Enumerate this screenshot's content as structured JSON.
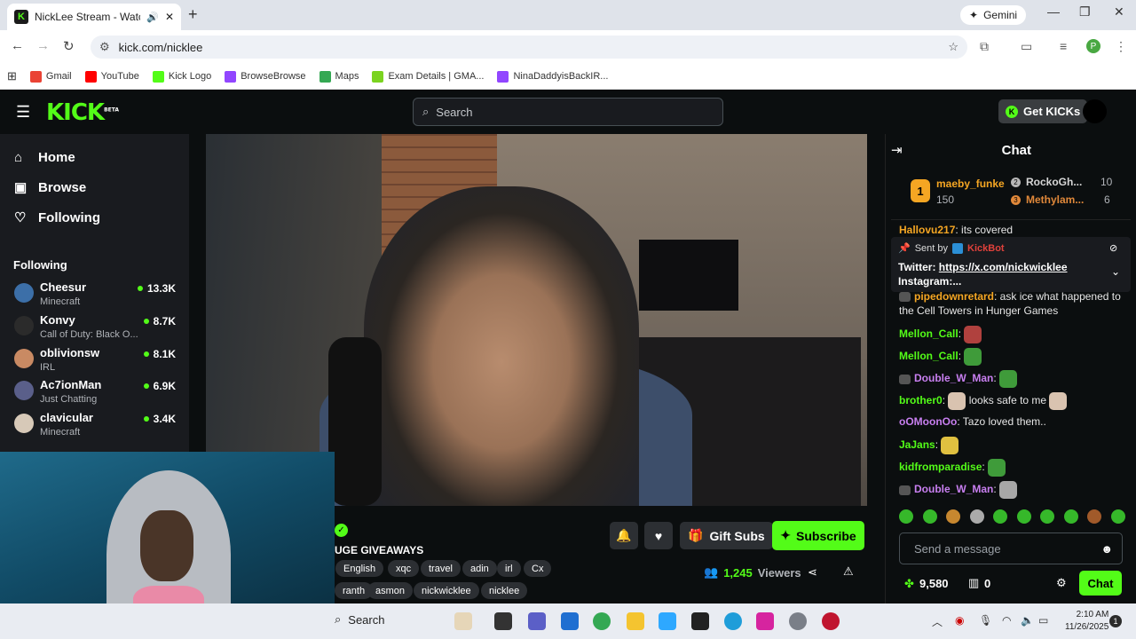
{
  "browser": {
    "tab_title": "NickLee Stream - Watch Liv",
    "gemini_label": "Gemini",
    "url": "kick.com/nicklee",
    "profile_initial": "P",
    "bookmarks": [
      {
        "label": "Gmail",
        "color": "#ea4335"
      },
      {
        "label": "YouTube",
        "color": "#ff0000"
      },
      {
        "label": "Kick Logo",
        "color": "#53fc18"
      },
      {
        "label": "BrowseBrowse",
        "color": "#9146ff"
      },
      {
        "label": "Maps",
        "color": "#34a853"
      },
      {
        "label": "Exam Details | GMA...",
        "color": "#7bd320"
      },
      {
        "label": "NinaDaddyisBackIR...",
        "color": "#9146ff"
      }
    ]
  },
  "header": {
    "logo": "KICK",
    "logo_badge": "BETA",
    "search_placeholder": "Search",
    "get_kicks_label": "Get KICKs"
  },
  "sidebar": {
    "nav": [
      {
        "label": "Home",
        "icon": "home-icon"
      },
      {
        "label": "Browse",
        "icon": "browse-icon"
      },
      {
        "label": "Following",
        "icon": "heart-icon"
      }
    ],
    "following_heading": "Following",
    "following": [
      {
        "name": "Cheesur",
        "category": "Minecraft",
        "viewers": "13.3K",
        "avatar_color": "#3c6fa8"
      },
      {
        "name": "Konvy",
        "category": "Call of Duty: Black O...",
        "viewers": "8.7K",
        "avatar_color": "#2b2b2b"
      },
      {
        "name": "oblivionsw",
        "category": "IRL",
        "viewers": "8.1K",
        "avatar_color": "#c98a63"
      },
      {
        "name": "Ac7ionMan",
        "category": "Just Chatting",
        "viewers": "6.9K",
        "avatar_color": "#5a5f8a"
      },
      {
        "name": "clavicular",
        "category": "Minecraft",
        "viewers": "3.4K",
        "avatar_color": "#d7c9b8"
      }
    ]
  },
  "stream": {
    "title": "UGE GIVEAWAYS",
    "tags": [
      "English",
      "xqc",
      "travel",
      "adin",
      "irl",
      "Cx",
      "ranth",
      "asmon",
      "nickwicklee",
      "nicklee"
    ],
    "gift_subs_label": "Gift Subs",
    "subscribe_label": "Subscribe",
    "viewer_count": "1,245",
    "viewers_label": "Viewers"
  },
  "chat": {
    "title": "Chat",
    "leaderboard": [
      {
        "rank": "1",
        "name": "maeby_funke",
        "count": "150",
        "color": "#f5a623"
      },
      {
        "rank": "2",
        "name": "RockoGh...",
        "count": "10",
        "color": "#b7b7b7"
      },
      {
        "rank": "3",
        "name": "Methylam...",
        "count": "6",
        "color": "#e0883a"
      }
    ],
    "partial_msg_user": "Hallovu217",
    "partial_msg_text": ": its covered",
    "pinned_sent_by": "Sent by",
    "pinned_bot": "KickBot",
    "pinned_line1_label": "Twitter:",
    "pinned_line1_link": "https://x.com/nickwicklee",
    "pinned_line2": "Instagram:...",
    "messages": [
      {
        "user": "pipedownretard",
        "text": ": ask ice what happened to the Cell Towers in Hunger Games",
        "color": "#f5a623",
        "badge": true
      },
      {
        "user": "Mellon_Call",
        "text": ":",
        "color": "#53fc18",
        "badge": false,
        "emote": "#b0413e"
      },
      {
        "user": "Mellon_Call",
        "text": ":",
        "color": "#53fc18",
        "badge": false,
        "emote": "#3f9b3a"
      },
      {
        "user": "Double_W_Man",
        "text": ":",
        "color": "#c87ff0",
        "badge": true,
        "emote": "#3f9b3a"
      },
      {
        "user": "brother0",
        "text": ":",
        "color": "#53fc18",
        "badge": false,
        "emote": "#d9c3b0",
        "trail": "looks safe to me"
      },
      {
        "user": "oOMoonOo",
        "text": ": Tazo loved them..",
        "color": "#c87ff0",
        "badge": false
      },
      {
        "user": "JaJans",
        "text": ":",
        "color": "#53fc18",
        "badge": false,
        "emote": "#e0c040"
      },
      {
        "user": "kidfromparadise",
        "text": ":",
        "color": "#53fc18",
        "badge": false,
        "emote": "#3f9b3a"
      },
      {
        "user": "Double_W_Man",
        "text": ":",
        "color": "#c87ff0",
        "badge": true,
        "emote": "#a7a7a7"
      }
    ],
    "message_placeholder": "Send a message",
    "points": "9,580",
    "drops": "0",
    "chat_button": "Chat"
  },
  "taskbar": {
    "search_label": "Search",
    "time": "2:10 AM",
    "date": "11/26/2025",
    "notifications": "1"
  },
  "colors": {
    "accent": "#53fc18",
    "background": "#0b0e0f",
    "panel": "#191b1f"
  }
}
